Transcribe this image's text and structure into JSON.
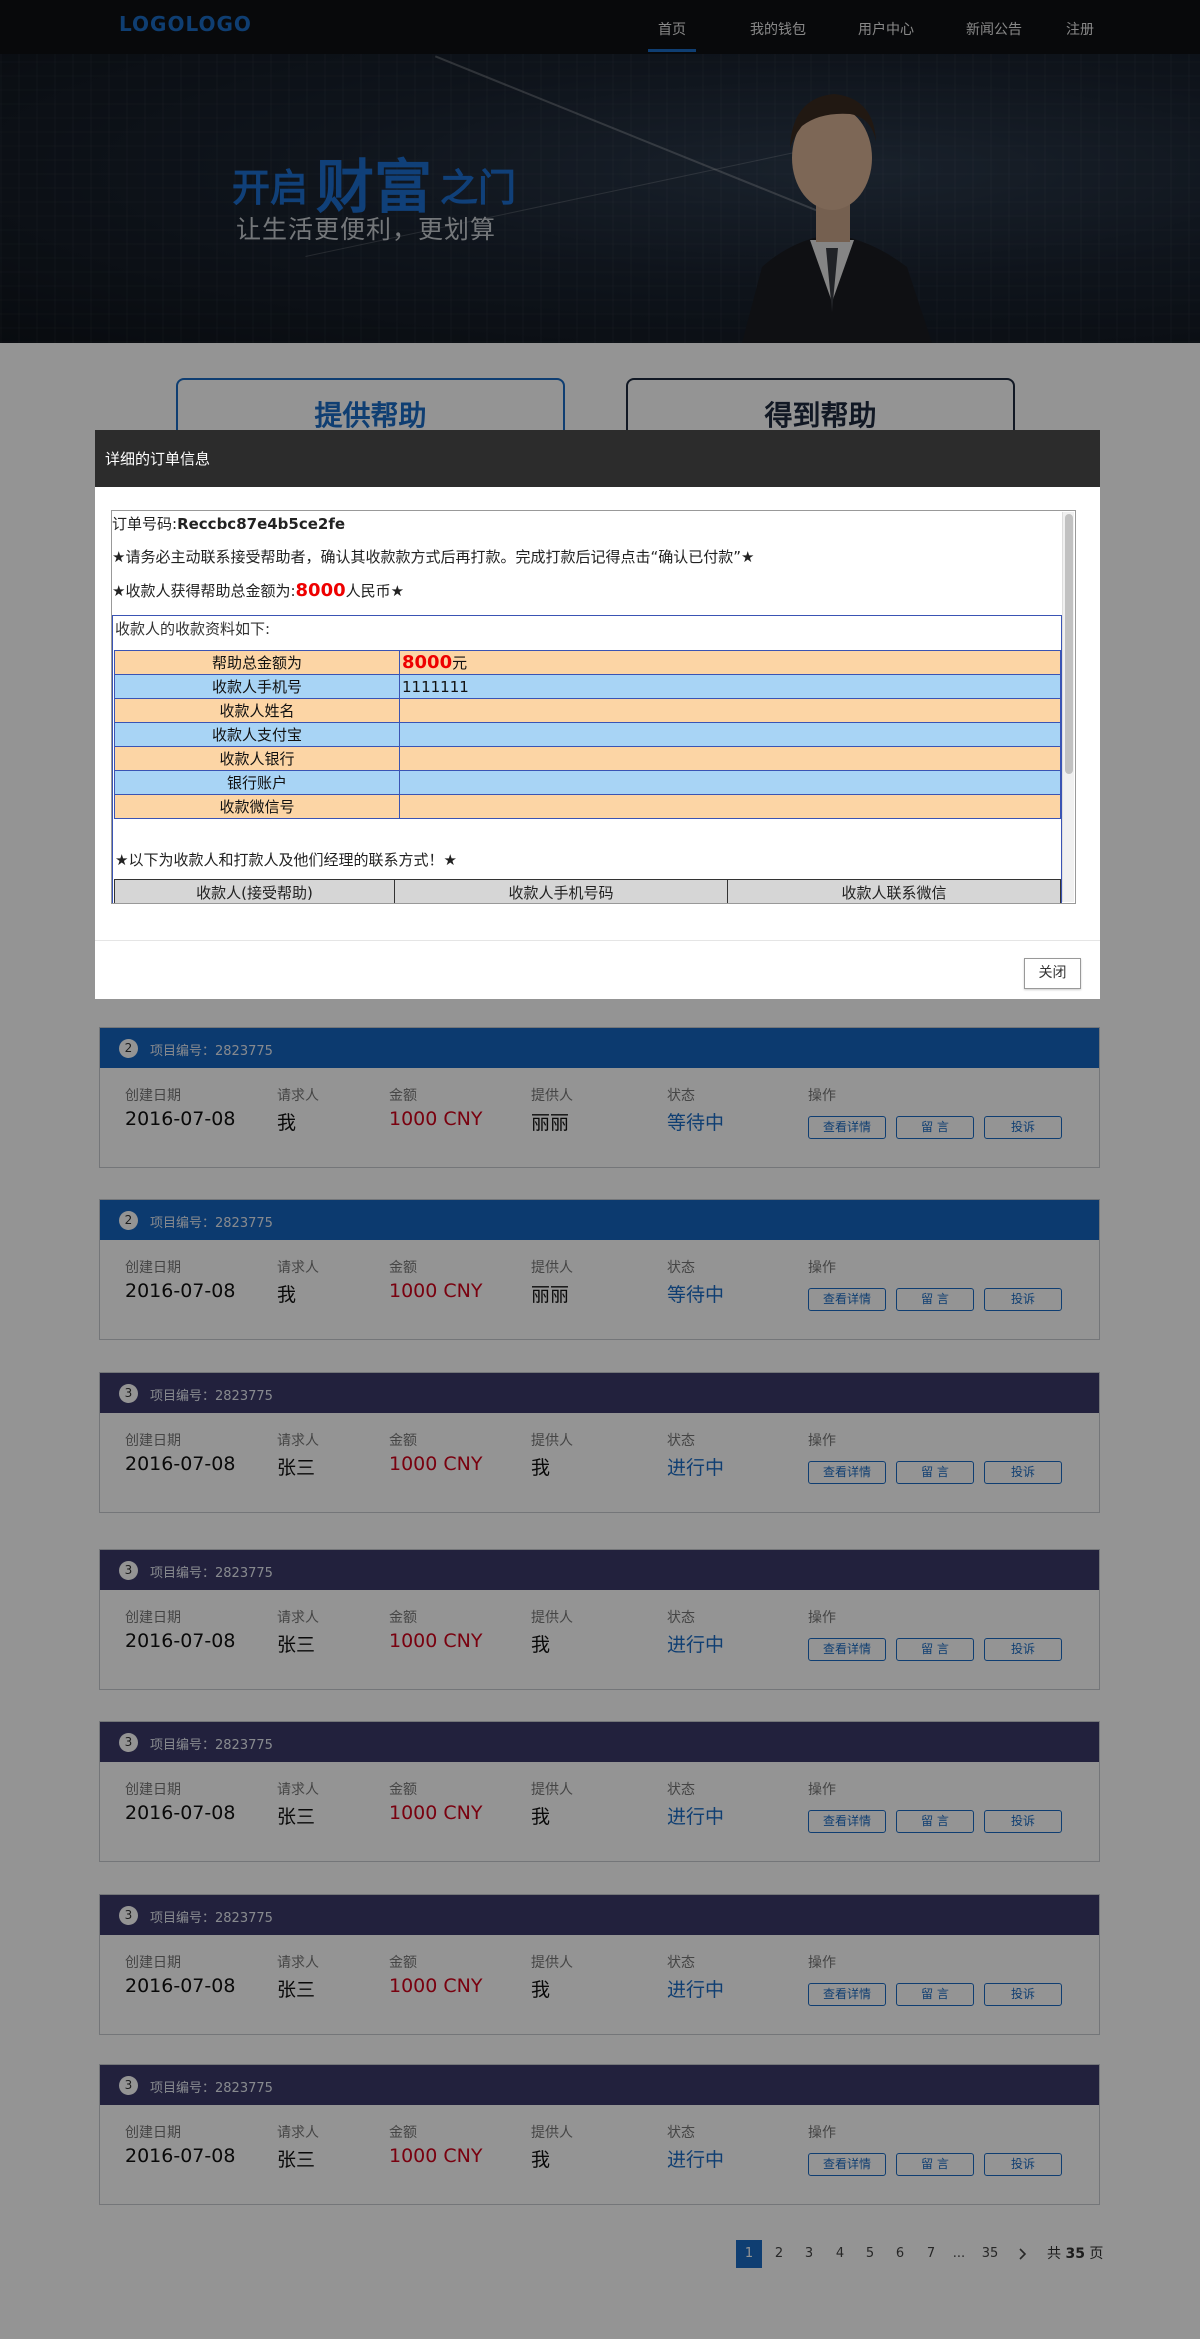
{
  "nav": {
    "logo": "LOGOLOGO",
    "links": [
      {
        "label": "首页",
        "active": true
      },
      {
        "label": "我的钱包"
      },
      {
        "label": "用户中心"
      },
      {
        "label": "新闻公告"
      },
      {
        "label": "注册"
      }
    ]
  },
  "banner": {
    "slogan_pre": "开启",
    "slogan_big": "财富",
    "slogan_post": "之门",
    "subtitle": "让生活更便利，更划算"
  },
  "help": {
    "give_label": "提供帮助",
    "get_label": "得到帮助"
  },
  "modal": {
    "title": "详细的订单信息",
    "order_label": "订单号码:",
    "order_no": "Reccbc87e4b5ce2fe",
    "notice": "★请务必主动联系接受帮助者，确认其收款款方式后再打款。完成打款后记得点击“确认已付款”★",
    "amount_pre": "★收款人获得帮助总金额为:",
    "amount": "8000",
    "amount_post": "人民币★",
    "info_caption": "收款人的收款资料如下:",
    "info_rows": [
      {
        "key": "帮助总金额为",
        "value": "8000",
        "unit": "元"
      },
      {
        "key": "收款人手机号",
        "value": "1111111"
      },
      {
        "key": "收款人姓名",
        "value": ""
      },
      {
        "key": "收款人支付宝",
        "value": ""
      },
      {
        "key": "收款人银行",
        "value": ""
      },
      {
        "key": "银行账户",
        "value": ""
      },
      {
        "key": "收款微信号",
        "value": ""
      }
    ],
    "contact_line": "★以下为收款人和打款人及他们经理的联系方式！★",
    "contact_headers": [
      "收款人(接受帮助)",
      "收款人手机号码",
      "收款人联系微信"
    ],
    "close_label": "关闭"
  },
  "card_labels": {
    "date": "创建日期",
    "requester": "请求人",
    "amount": "金额",
    "provider": "提供人",
    "status": "状态",
    "ops": "操作",
    "btn_detail": "查看详情",
    "btn_msg": "留 言",
    "btn_complain": "投诉"
  },
  "orders": [
    {
      "badge": "2",
      "title": "项目编号：2823775",
      "date": "2016-07-08",
      "requester": "我",
      "amount": "1000 CNY",
      "provider": "丽丽",
      "status": "等待中",
      "theme": "blue"
    },
    {
      "badge": "2",
      "title": "项目编号：2823775",
      "date": "2016-07-08",
      "requester": "我",
      "amount": "1000 CNY",
      "provider": "丽丽",
      "status": "等待中",
      "theme": "blue"
    },
    {
      "badge": "3",
      "title": "项目编号：2823775",
      "date": "2016-07-08",
      "requester": "张三",
      "amount": "1000 CNY",
      "provider": "我",
      "status": "进行中",
      "theme": "dark"
    },
    {
      "badge": "3",
      "title": "项目编号：2823775",
      "date": "2016-07-08",
      "requester": "张三",
      "amount": "1000 CNY",
      "provider": "我",
      "status": "进行中",
      "theme": "dark"
    },
    {
      "badge": "3",
      "title": "项目编号：2823775",
      "date": "2016-07-08",
      "requester": "张三",
      "amount": "1000 CNY",
      "provider": "我",
      "status": "进行中",
      "theme": "dark"
    },
    {
      "badge": "3",
      "title": "项目编号：2823775",
      "date": "2016-07-08",
      "requester": "张三",
      "amount": "1000 CNY",
      "provider": "我",
      "status": "进行中",
      "theme": "dark"
    },
    {
      "badge": "3",
      "title": "项目编号：2823775",
      "date": "2016-07-08",
      "requester": "张三",
      "amount": "1000 CNY",
      "provider": "我",
      "status": "进行中",
      "theme": "dark"
    }
  ],
  "pagination": {
    "pages": [
      "1",
      "2",
      "3",
      "4",
      "5",
      "6",
      "7",
      "...",
      "35"
    ],
    "current": "1",
    "next_icon": "chevron-right-icon",
    "total_pre": "共",
    "total": "35",
    "total_post": "页"
  },
  "colors": {
    "accent": "#1a6cc4",
    "dark_head": "#3b3a6a",
    "amount_red": "#d0021b"
  }
}
